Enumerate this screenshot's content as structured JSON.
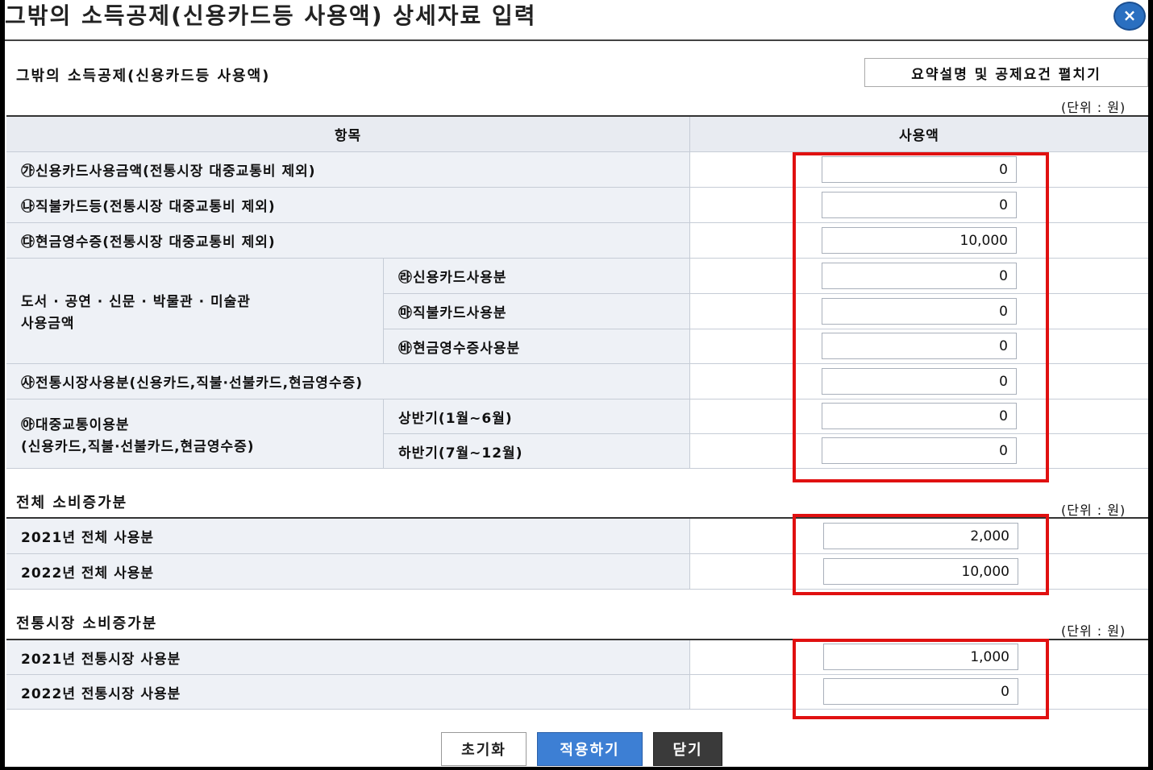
{
  "dialog": {
    "title": "그밖의 소득공제(신용카드등 사용액) 상세자료 입력",
    "close_label": "×"
  },
  "section1": {
    "title": "그밖의 소득공제(신용카드등 사용액)",
    "expand_label": "요약설명 및 공제요건 펼치기",
    "unit": "(단위 : 원)",
    "col_item": "항목",
    "col_amount": "사용액",
    "rows": [
      {
        "label": "㉮신용카드사용금액(전통시장 대중교통비 제외)",
        "value": "0"
      },
      {
        "label": "㉯직불카드등(전통시장 대중교통비 제외)",
        "value": "0"
      },
      {
        "label": "㉰현금영수증(전통시장 대중교통비 제외)",
        "value": "10,000"
      },
      {
        "label": "㉱신용카드사용분",
        "value": "0"
      },
      {
        "label": "㉲직불카드사용분",
        "value": "0"
      },
      {
        "label": "㉳현금영수증사용분",
        "value": "0"
      },
      {
        "label": "㉴전통시장사용분(신용카드,직불·선불카드,현금영수증)",
        "value": "0"
      },
      {
        "label": "상반기(1월~6월)",
        "value": "0"
      },
      {
        "label": "하반기(7월~12월)",
        "value": "0"
      }
    ],
    "group_culture_line1": "도서 · 공연 · 신문 · 박물관 · 미술관",
    "group_culture_line2": "사용금액",
    "group_transit_line1": "㉵대중교통이용분",
    "group_transit_line2": "(신용카드,직불·선불카드,현금영수증)"
  },
  "section2": {
    "title": "전체 소비증가분",
    "unit": "(단위 : 원)",
    "rows": [
      {
        "label": "2021년 전체 사용분",
        "value": "2,000"
      },
      {
        "label": "2022년 전체 사용분",
        "value": "10,000"
      }
    ]
  },
  "section3": {
    "title": "전통시장 소비증가분",
    "unit": "(단위 : 원)",
    "rows": [
      {
        "label": "2021년 전통시장 사용분",
        "value": "1,000"
      },
      {
        "label": "2022년 전통시장 사용분",
        "value": "0"
      }
    ]
  },
  "buttons": {
    "reset": "초기화",
    "apply": "적용하기",
    "close": "닫기"
  },
  "colors": {
    "highlight": "#e01010",
    "apply_button": "#3d7fd4",
    "close_button": "#3a3a3a",
    "header_bg": "#e8ebf1",
    "label_bg": "#eef1f6"
  }
}
